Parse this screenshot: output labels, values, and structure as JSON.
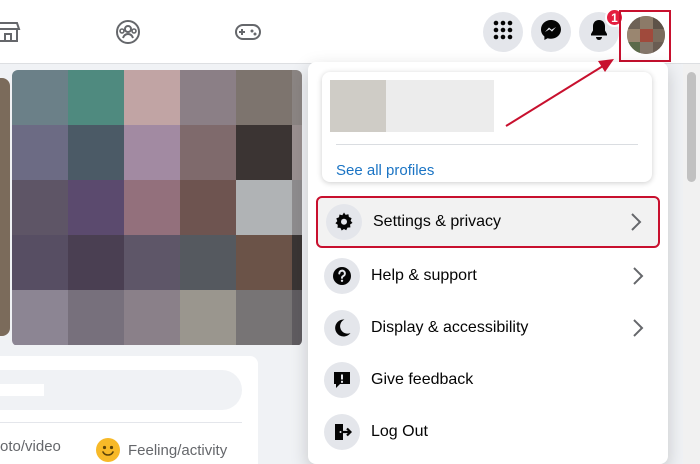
{
  "topbar": {
    "nav_icons": [
      "marketplace-icon",
      "groups-icon",
      "gaming-icon"
    ],
    "actions": [
      "menu-grid-icon",
      "messenger-icon",
      "bell-icon"
    ],
    "notification_count": "1"
  },
  "profile_menu": {
    "see_all_profiles": "See all profiles",
    "items": [
      {
        "label": "Settings & privacy",
        "icon": "gear-icon",
        "has_chevron": true
      },
      {
        "label": "Help & support",
        "icon": "question-icon",
        "has_chevron": true
      },
      {
        "label": "Display & accessibility",
        "icon": "moon-icon",
        "has_chevron": true
      },
      {
        "label": "Give feedback",
        "icon": "feedback-icon",
        "has_chevron": false
      },
      {
        "label": "Log Out",
        "icon": "logout-icon",
        "has_chevron": false
      }
    ]
  },
  "composer": {
    "photo_video": "oto/video",
    "feeling_activity": "Feeling/activity"
  },
  "colors": {
    "accent_link": "#1b74c4",
    "annotation_red": "#c8102e",
    "notification_badge": "#e41e3f"
  }
}
